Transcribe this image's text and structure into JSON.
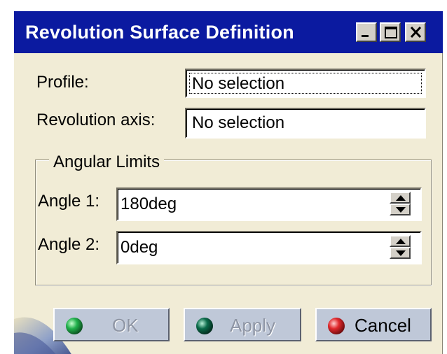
{
  "window": {
    "title": "Revolution Surface Definition",
    "controls": {
      "minimize_icon": "minimize-icon",
      "maximize_icon": "maximize-icon",
      "close_icon": "close-icon"
    }
  },
  "profile": {
    "label": "Profile:",
    "value": "No selection"
  },
  "axis": {
    "label": "Revolution axis:",
    "value": "No selection"
  },
  "angular_limits": {
    "title": "Angular Limits",
    "angle1": {
      "label": "Angle 1:",
      "value": "180deg"
    },
    "angle2": {
      "label": "Angle 2:",
      "value": "0deg"
    }
  },
  "buttons": {
    "ok": {
      "label": "OK",
      "enabled": false,
      "bulb_color": "#22b14c"
    },
    "apply": {
      "label": "Apply",
      "enabled": false,
      "bulb_color": "#0b6b4a"
    },
    "cancel": {
      "label": "Cancel",
      "enabled": true,
      "bulb_color": "#e0282c"
    }
  },
  "colors": {
    "title_bar": "#0b1aa0",
    "dialog_bg": "#f1ecd6",
    "button_bg": "#bfc8d8"
  }
}
